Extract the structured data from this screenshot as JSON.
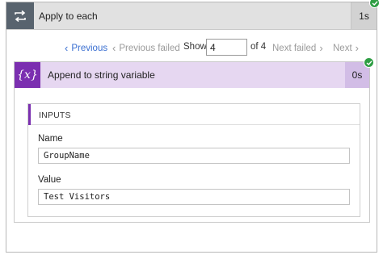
{
  "loop": {
    "title": "Apply to each",
    "duration": "1s",
    "icon": "loop-icon",
    "status_icon": "check-icon"
  },
  "pager": {
    "previous": "Previous",
    "previous_failed": "Previous failed",
    "show_label": "Show",
    "current_page": "4",
    "of_total": "of 4",
    "next_failed": "Next failed",
    "next": "Next"
  },
  "action": {
    "title": "Append to string variable",
    "duration": "0s",
    "icon": "variable-icon",
    "icon_glyph": "{x}",
    "status_icon": "check-icon",
    "accent_color": "#7b2fb0"
  },
  "inputs": {
    "header": "INPUTS",
    "fields": [
      {
        "label": "Name",
        "value": "GroupName"
      },
      {
        "label": "Value",
        "value": "Test Visitors"
      }
    ]
  },
  "colors": {
    "success": "#2f9e44",
    "link": "#3a6fd1",
    "disabled": "#9a9a9a",
    "loop_icon_bg": "#58636e"
  }
}
